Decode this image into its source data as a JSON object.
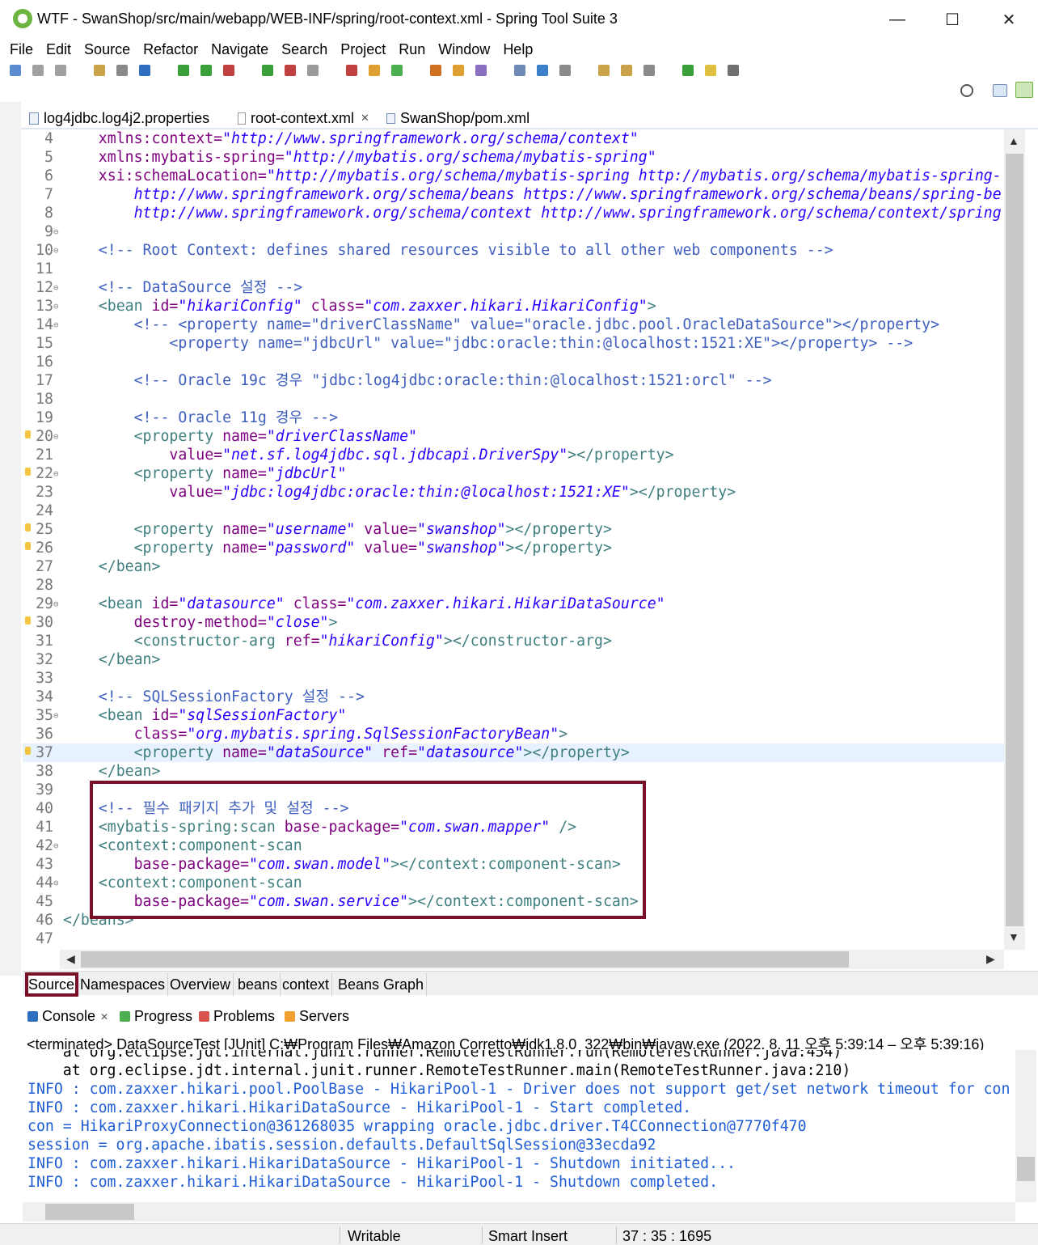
{
  "window": {
    "title": "WTF - SwanShop/src/main/webapp/WEB-INF/spring/root-context.xml - Spring Tool Suite 3",
    "minimize": "—",
    "maximize": "☐",
    "close": "✕"
  },
  "menu": [
    "File",
    "Edit",
    "Source",
    "Refactor",
    "Navigate",
    "Search",
    "Project",
    "Run",
    "Window",
    "Help"
  ],
  "editor_tabs": [
    {
      "label": "log4jdbc.log4j2.properties",
      "active": false
    },
    {
      "label": "root-context.xml",
      "active": true,
      "close": "✕"
    },
    {
      "label": "SwanShop/pom.xml",
      "active": false
    }
  ],
  "editor": {
    "current_line": 37,
    "lines": [
      {
        "n": "4",
        "fold": "",
        "mark": false,
        "code": [
          {
            "t": "    xmlns:context=",
            "c": "attr"
          },
          {
            "t": "\"http://www.springframework.org/schema/context\"",
            "c": "val"
          }
        ]
      },
      {
        "n": "5",
        "fold": "",
        "mark": false,
        "code": [
          {
            "t": "    xmlns:mybatis-spring=",
            "c": "attr"
          },
          {
            "t": "\"http://mybatis.org/schema/mybatis-spring\"",
            "c": "val"
          }
        ]
      },
      {
        "n": "6",
        "fold": "",
        "mark": false,
        "code": [
          {
            "t": "    xsi:schemaLocation=",
            "c": "attr"
          },
          {
            "t": "\"http://mybatis.org/schema/mybatis-spring http://mybatis.org/schema/mybatis-spring-",
            "c": "val"
          }
        ]
      },
      {
        "n": "7",
        "fold": "",
        "mark": false,
        "code": [
          {
            "t": "        http://www.springframework.org/schema/beans https://www.springframework.org/schema/beans/spring-be",
            "c": "val"
          }
        ]
      },
      {
        "n": "8",
        "fold": "",
        "mark": false,
        "code": [
          {
            "t": "        http://www.springframework.org/schema/context http://www.springframework.org/schema/context/spring",
            "c": "val"
          }
        ]
      },
      {
        "n": "9",
        "fold": "⊖",
        "mark": false,
        "code": []
      },
      {
        "n": "10",
        "fold": "⊖",
        "mark": false,
        "code": [
          {
            "t": "    <!-- Root Context: defines shared resources visible to all other web components -->",
            "c": "com"
          }
        ]
      },
      {
        "n": "11",
        "fold": "",
        "mark": false,
        "code": []
      },
      {
        "n": "12",
        "fold": "⊖",
        "mark": false,
        "code": [
          {
            "t": "    <!-- DataSource 설정 -->",
            "c": "com"
          }
        ]
      },
      {
        "n": "13",
        "fold": "⊖",
        "mark": false,
        "code": [
          {
            "t": "    <bean ",
            "c": "tag"
          },
          {
            "t": "id=",
            "c": "attr"
          },
          {
            "t": "\"hikariConfig\"",
            "c": "val"
          },
          {
            "t": " class=",
            "c": "attr"
          },
          {
            "t": "\"com.zaxxer.hikari.HikariConfig\"",
            "c": "val"
          },
          {
            "t": ">",
            "c": "tag"
          }
        ]
      },
      {
        "n": "14",
        "fold": "⊖",
        "mark": false,
        "code": [
          {
            "t": "        <!-- <property name=\"driverClassName\" value=\"oracle.jdbc.pool.OracleDataSource\"></property>",
            "c": "com"
          }
        ]
      },
      {
        "n": "15",
        "fold": "",
        "mark": false,
        "code": [
          {
            "t": "            <property name=\"jdbcUrl\" value=\"jdbc:oracle:thin:@localhost:1521:XE\"></property> -->",
            "c": "com"
          }
        ]
      },
      {
        "n": "16",
        "fold": "",
        "mark": false,
        "code": []
      },
      {
        "n": "17",
        "fold": "",
        "mark": false,
        "code": [
          {
            "t": "        <!-- Oracle 19c 경우 \"jdbc:log4jdbc:oracle:thin:@localhost:1521:orcl\" -->",
            "c": "com"
          }
        ]
      },
      {
        "n": "18",
        "fold": "",
        "mark": false,
        "code": []
      },
      {
        "n": "19",
        "fold": "",
        "mark": false,
        "code": [
          {
            "t": "        <!-- Oracle 11g 경우 -->",
            "c": "com"
          }
        ]
      },
      {
        "n": "20",
        "fold": "⊖",
        "mark": true,
        "code": [
          {
            "t": "        <property ",
            "c": "tag"
          },
          {
            "t": "name=",
            "c": "attr"
          },
          {
            "t": "\"driverClassName\"",
            "c": "val"
          }
        ]
      },
      {
        "n": "21",
        "fold": "",
        "mark": false,
        "code": [
          {
            "t": "            value=",
            "c": "attr"
          },
          {
            "t": "\"net.sf.log4jdbc.sql.jdbcapi.DriverSpy\"",
            "c": "val"
          },
          {
            "t": "></property>",
            "c": "tag"
          }
        ]
      },
      {
        "n": "22",
        "fold": "⊖",
        "mark": true,
        "code": [
          {
            "t": "        <property ",
            "c": "tag"
          },
          {
            "t": "name=",
            "c": "attr"
          },
          {
            "t": "\"jdbcUrl\"",
            "c": "val"
          }
        ]
      },
      {
        "n": "23",
        "fold": "",
        "mark": false,
        "code": [
          {
            "t": "            value=",
            "c": "attr"
          },
          {
            "t": "\"jdbc:log4jdbc:oracle:thin:@localhost:1521:XE\"",
            "c": "val"
          },
          {
            "t": "></property>",
            "c": "tag"
          }
        ]
      },
      {
        "n": "24",
        "fold": "",
        "mark": false,
        "code": []
      },
      {
        "n": "25",
        "fold": "",
        "mark": true,
        "code": [
          {
            "t": "        <property ",
            "c": "tag"
          },
          {
            "t": "name=",
            "c": "attr"
          },
          {
            "t": "\"username\"",
            "c": "val"
          },
          {
            "t": " value=",
            "c": "attr"
          },
          {
            "t": "\"swanshop\"",
            "c": "val"
          },
          {
            "t": "></property>",
            "c": "tag"
          }
        ]
      },
      {
        "n": "26",
        "fold": "",
        "mark": true,
        "code": [
          {
            "t": "        <property ",
            "c": "tag"
          },
          {
            "t": "name=",
            "c": "attr"
          },
          {
            "t": "\"password\"",
            "c": "val"
          },
          {
            "t": " value=",
            "c": "attr"
          },
          {
            "t": "\"swanshop\"",
            "c": "val"
          },
          {
            "t": "></property>",
            "c": "tag"
          }
        ]
      },
      {
        "n": "27",
        "fold": "",
        "mark": false,
        "code": [
          {
            "t": "    </bean>",
            "c": "tag"
          }
        ]
      },
      {
        "n": "28",
        "fold": "",
        "mark": false,
        "code": []
      },
      {
        "n": "29",
        "fold": "⊖",
        "mark": false,
        "code": [
          {
            "t": "    <bean ",
            "c": "tag"
          },
          {
            "t": "id=",
            "c": "attr"
          },
          {
            "t": "\"datasource\"",
            "c": "val"
          },
          {
            "t": " class=",
            "c": "attr"
          },
          {
            "t": "\"com.zaxxer.hikari.HikariDataSource\"",
            "c": "val"
          }
        ]
      },
      {
        "n": "30",
        "fold": "",
        "mark": true,
        "code": [
          {
            "t": "        destroy-method=",
            "c": "attr"
          },
          {
            "t": "\"close\"",
            "c": "val"
          },
          {
            "t": ">",
            "c": "tag"
          }
        ]
      },
      {
        "n": "31",
        "fold": "",
        "mark": false,
        "code": [
          {
            "t": "        <constructor-arg ",
            "c": "tag"
          },
          {
            "t": "ref=",
            "c": "attr"
          },
          {
            "t": "\"hikariConfig\"",
            "c": "val"
          },
          {
            "t": "></constructor-arg>",
            "c": "tag"
          }
        ]
      },
      {
        "n": "32",
        "fold": "",
        "mark": false,
        "code": [
          {
            "t": "    </bean>",
            "c": "tag"
          }
        ]
      },
      {
        "n": "33",
        "fold": "",
        "mark": false,
        "code": []
      },
      {
        "n": "34",
        "fold": "",
        "mark": false,
        "code": [
          {
            "t": "    <!-- SQLSessionFactory 설정 -->",
            "c": "com"
          }
        ]
      },
      {
        "n": "35",
        "fold": "⊖",
        "mark": false,
        "code": [
          {
            "t": "    <bean ",
            "c": "tag"
          },
          {
            "t": "id=",
            "c": "attr"
          },
          {
            "t": "\"sqlSessionFactory\"",
            "c": "val"
          }
        ]
      },
      {
        "n": "36",
        "fold": "",
        "mark": false,
        "code": [
          {
            "t": "        class=",
            "c": "attr"
          },
          {
            "t": "\"org.mybatis.spring.SqlSessionFactoryBean\"",
            "c": "val"
          },
          {
            "t": ">",
            "c": "tag"
          }
        ]
      },
      {
        "n": "37",
        "fold": "",
        "mark": true,
        "code": [
          {
            "t": "        <property ",
            "c": "tag"
          },
          {
            "t": "name=",
            "c": "attr"
          },
          {
            "t": "\"dataSource\"",
            "c": "val"
          },
          {
            "t": " ref=",
            "c": "attr"
          },
          {
            "t": "\"datasource\"",
            "c": "val"
          },
          {
            "t": "></property>",
            "c": "tag"
          }
        ]
      },
      {
        "n": "38",
        "fold": "",
        "mark": false,
        "code": [
          {
            "t": "    </bean>",
            "c": "tag"
          }
        ]
      },
      {
        "n": "39",
        "fold": "",
        "mark": false,
        "code": []
      },
      {
        "n": "40",
        "fold": "",
        "mark": false,
        "code": [
          {
            "t": "    <!-- 필수 패키지 추가 및 설정 -->",
            "c": "com"
          }
        ]
      },
      {
        "n": "41",
        "fold": "",
        "mark": false,
        "code": [
          {
            "t": "    <mybatis-spring:scan ",
            "c": "tag"
          },
          {
            "t": "base-package=",
            "c": "attr"
          },
          {
            "t": "\"com.swan.mapper\"",
            "c": "val"
          },
          {
            "t": " />",
            "c": "tag"
          }
        ]
      },
      {
        "n": "42",
        "fold": "⊖",
        "mark": false,
        "code": [
          {
            "t": "    <context:component-scan",
            "c": "tag"
          }
        ]
      },
      {
        "n": "43",
        "fold": "",
        "mark": false,
        "code": [
          {
            "t": "        base-package=",
            "c": "attr"
          },
          {
            "t": "\"com.swan.model\"",
            "c": "val"
          },
          {
            "t": "></context:component-scan>",
            "c": "tag"
          }
        ]
      },
      {
        "n": "44",
        "fold": "⊖",
        "mark": false,
        "code": [
          {
            "t": "    <context:component-scan",
            "c": "tag"
          }
        ]
      },
      {
        "n": "45",
        "fold": "",
        "mark": false,
        "code": [
          {
            "t": "        base-package=",
            "c": "attr"
          },
          {
            "t": "\"com.swan.service\"",
            "c": "val"
          },
          {
            "t": "></context:component-scan>",
            "c": "tag"
          }
        ]
      },
      {
        "n": "46",
        "fold": "",
        "mark": false,
        "code": [
          {
            "t": "</beans>",
            "c": "tag"
          }
        ]
      },
      {
        "n": "47",
        "fold": "",
        "mark": false,
        "code": []
      }
    ]
  },
  "page_tabs": [
    {
      "label": "Source",
      "active": true
    },
    {
      "label": "Namespaces",
      "active": false
    },
    {
      "label": "Overview",
      "active": false
    },
    {
      "label": "beans",
      "active": false
    },
    {
      "label": "context",
      "active": false
    },
    {
      "label": "Beans Graph",
      "active": false
    }
  ],
  "console_view": {
    "tabs": [
      "Console",
      "Progress",
      "Problems",
      "Servers"
    ],
    "close": "✕",
    "description": "<terminated> DataSourceTest [JUnit] C:₩Program Files₩Amazon Corretto₩jdk1.8.0_322₩bin₩javaw.exe  (2022. 8. 11 오후 5:39:14 – 오후 5:39:16)",
    "lines": [
      {
        "t": "    at org.eclipse.jdt.internal.junit.runner.RemoteTestRunner.run(RemoteTestRunner.java:454)",
        "k": "plain"
      },
      {
        "t": "    at org.eclipse.jdt.internal.junit.runner.RemoteTestRunner.main(RemoteTestRunner.java:210)",
        "k": "plain"
      },
      {
        "t": "INFO : com.zaxxer.hikari.pool.PoolBase - HikariPool-1 - Driver does not support get/set network timeout for con",
        "k": "info"
      },
      {
        "t": "INFO : com.zaxxer.hikari.HikariDataSource - HikariPool-1 - Start completed.",
        "k": "info"
      },
      {
        "t": "con = HikariProxyConnection@361268035 wrapping oracle.jdbc.driver.T4CConnection@7770f470",
        "k": "info"
      },
      {
        "t": "session = org.apache.ibatis.session.defaults.DefaultSqlSession@33ecda92",
        "k": "info"
      },
      {
        "t": "INFO : com.zaxxer.hikari.HikariDataSource - HikariPool-1 - Shutdown initiated...",
        "k": "info"
      },
      {
        "t": "INFO : com.zaxxer.hikari.HikariDataSource - HikariPool-1 - Shutdown completed.",
        "k": "info"
      }
    ]
  },
  "status": {
    "writable": "Writable",
    "insert_mode": "Smart Insert",
    "position": "37 : 35 : 1695"
  },
  "icons": [
    "app-logo-icon",
    "new-icon",
    "save-icon",
    "save-all-icon",
    "search-icon",
    "perspective-icon",
    "spring-perspective-icon",
    "scroll-up-icon",
    "scroll-down-icon",
    "scroll-left-icon",
    "scroll-right-icon"
  ],
  "colors": {
    "tag": "#3f7f7f",
    "attribute": "#7f007f",
    "value": "#2a00ff",
    "comment": "#3f5fbf",
    "highlight_box": "#7a1028",
    "console_info": "#1f5dd6",
    "current_line": "#e8f2fe"
  }
}
